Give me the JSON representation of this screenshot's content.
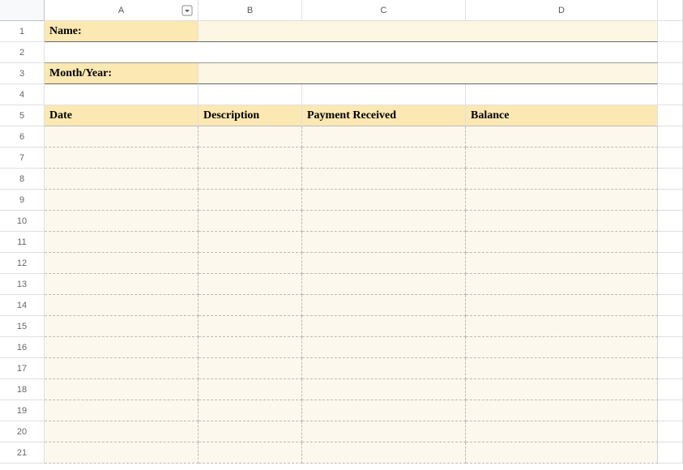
{
  "columns": [
    "A",
    "B",
    "C",
    "D"
  ],
  "rows": [
    "1",
    "2",
    "3",
    "4",
    "5",
    "6",
    "7",
    "8",
    "9",
    "10",
    "11",
    "12",
    "13",
    "14",
    "15",
    "16",
    "17",
    "18",
    "19",
    "20",
    "21"
  ],
  "labels": {
    "name": "Name:",
    "month_year": "Month/Year:"
  },
  "table_headers": {
    "date": "Date",
    "description": "Description",
    "payment_received": "Payment Received",
    "balance": "Balance"
  },
  "data_rows": [
    {
      "date": "",
      "description": "",
      "payment_received": "",
      "balance": ""
    },
    {
      "date": "",
      "description": "",
      "payment_received": "",
      "balance": ""
    },
    {
      "date": "",
      "description": "",
      "payment_received": "",
      "balance": ""
    },
    {
      "date": "",
      "description": "",
      "payment_received": "",
      "balance": ""
    },
    {
      "date": "",
      "description": "",
      "payment_received": "",
      "balance": ""
    },
    {
      "date": "",
      "description": "",
      "payment_received": "",
      "balance": ""
    },
    {
      "date": "",
      "description": "",
      "payment_received": "",
      "balance": ""
    },
    {
      "date": "",
      "description": "",
      "payment_received": "",
      "balance": ""
    },
    {
      "date": "",
      "description": "",
      "payment_received": "",
      "balance": ""
    },
    {
      "date": "",
      "description": "",
      "payment_received": "",
      "balance": ""
    },
    {
      "date": "",
      "description": "",
      "payment_received": "",
      "balance": ""
    },
    {
      "date": "",
      "description": "",
      "payment_received": "",
      "balance": ""
    },
    {
      "date": "",
      "description": "",
      "payment_received": "",
      "balance": ""
    },
    {
      "date": "",
      "description": "",
      "payment_received": "",
      "balance": ""
    },
    {
      "date": "",
      "description": "",
      "payment_received": "",
      "balance": ""
    },
    {
      "date": "",
      "description": "",
      "payment_received": "",
      "balance": ""
    }
  ]
}
